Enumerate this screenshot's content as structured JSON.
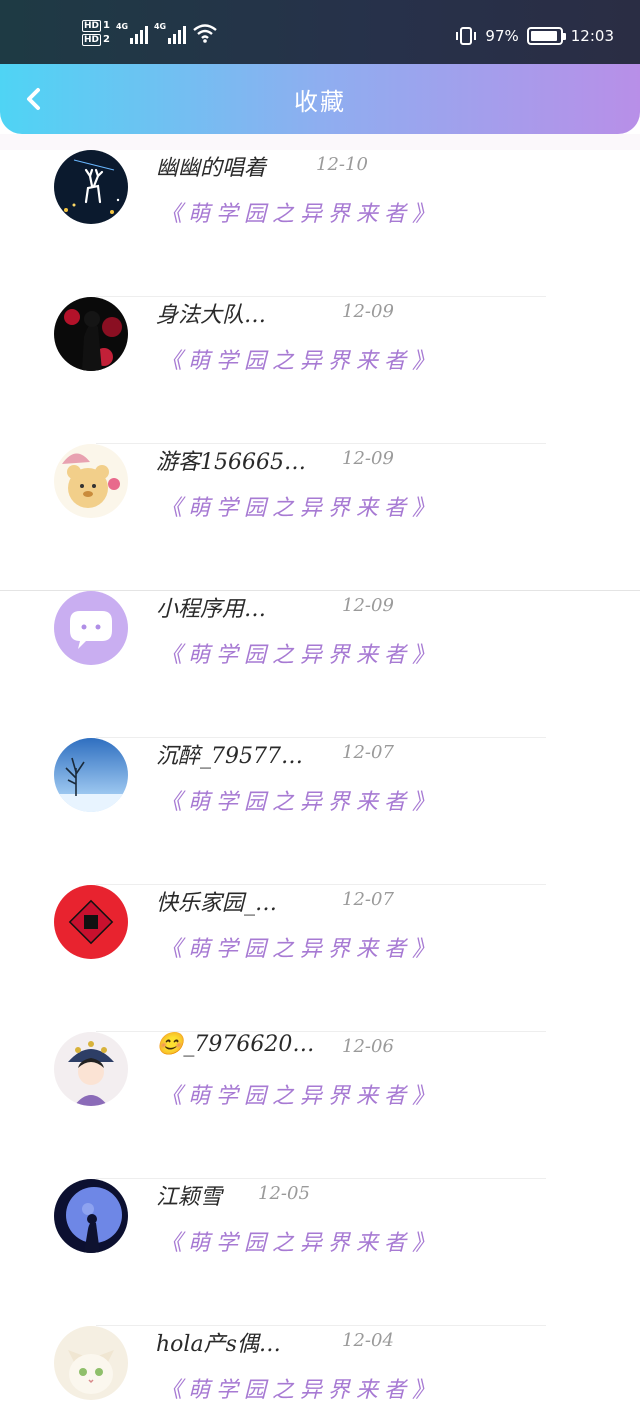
{
  "status_bar": {
    "sim1": "HD",
    "sim1_num": "1",
    "sim2": "HD",
    "sim2_num": "2",
    "net1": "4G",
    "net2": "4G",
    "battery_percent_text": "97%",
    "battery_level": 0.97,
    "time": "12:03"
  },
  "header": {
    "title": "收藏",
    "back_icon": "chevron-left-icon"
  },
  "favorites": [
    {
      "name": "幽幽的唱着",
      "date": "12-10",
      "book": "《萌学园之异界来者》",
      "avatar": "deer-night"
    },
    {
      "name": "身法大队…",
      "date": "12-09",
      "book": "《萌学园之异界来者》",
      "avatar": "red-silhouette"
    },
    {
      "name": "游客156665…",
      "date": "12-09",
      "book": "《萌学园之异界来者》",
      "avatar": "bear"
    },
    {
      "name": "小程序用…",
      "date": "12-09",
      "book": "《萌学园之异界来者》",
      "avatar": "chat-bubble"
    },
    {
      "name": "沉醉_79577…",
      "date": "12-07",
      "book": "《萌学园之异界来者》",
      "avatar": "winter-tree"
    },
    {
      "name": "快乐家园_…",
      "date": "12-07",
      "book": "《萌学园之异界来者》",
      "avatar": "fu-red"
    },
    {
      "name": "😊_7976620…",
      "date": "12-06",
      "book": "《萌学园之异界来者》",
      "avatar": "queen"
    },
    {
      "name": "江颖雪",
      "date": "12-05",
      "book": "《萌学园之异界来者》",
      "avatar": "blue-moon"
    },
    {
      "name": "hola产s偶…",
      "date": "12-04",
      "book": "《萌学园之异界来者》",
      "avatar": "cat"
    }
  ]
}
